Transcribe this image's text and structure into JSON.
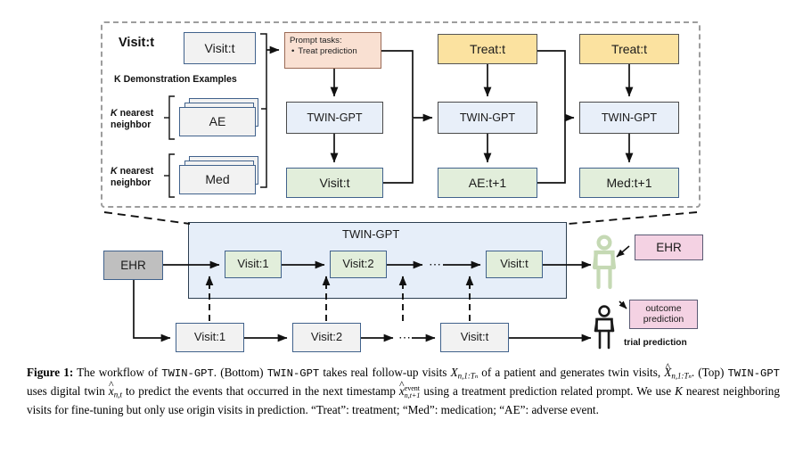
{
  "figure": {
    "top_panel": {
      "title_label": "Visit:t",
      "demo_label": "K Demonstration Examples",
      "knn_label_1_line1": "K",
      "knn_label_1_line2": " nearest",
      "knn_label_1_line3": "neighbor",
      "knn_label_2_line1": "K",
      "knn_label_2_line2": " nearest",
      "knn_label_2_line3": "neighbor",
      "visit_card": "Visit:t",
      "ae_stack": "AE",
      "med_stack": "Med",
      "prompt_title": "Prompt tasks:",
      "prompt_bullet": "Treat prediction",
      "twin_gpt_1": "TWIN-GPT",
      "twin_gpt_2": "TWIN-GPT",
      "twin_gpt_3": "TWIN-GPT",
      "out_1": "Visit:t",
      "out_2": "AE:t+1",
      "out_3": "Med:t+1",
      "treat_1": "Treat:t",
      "treat_2": "Treat:t"
    },
    "bottom_panel": {
      "panel_title": "TWIN-GPT",
      "ehr_source": "EHR",
      "twin_visits": [
        "Visit:1",
        "Visit:2",
        "Visit:t"
      ],
      "twin_ellipsis": "⋯",
      "real_visits": [
        "Visit:1",
        "Visit:2",
        "Visit:t"
      ],
      "real_ellipsis": "⋯",
      "ehr_result": "EHR",
      "outcome_line1": "outcome",
      "outcome_line2": "prediction",
      "trial_prediction": "trial prediction"
    },
    "colors": {
      "grey_box": "#f2f2f2",
      "blue_box": "#e8eff9",
      "green_box": "#e2eedb",
      "yellow_box": "#fbe2a0",
      "peach_box": "#f9e0d2",
      "pink_box": "#f4d2e3",
      "ehr_box": "#bfbfbf",
      "panel_blue": "#e6eef9",
      "dashed_border": "#9d9d9d",
      "twin_person": "#c5d9b4",
      "real_person": "#1a1a1a"
    }
  },
  "caption": {
    "figure_number": "Figure 1:",
    "seg_1": " The workflow of ",
    "mono_1": "TWIN-GPT",
    "seg_2": ". (Bottom) ",
    "mono_2": "TWIN-GPT",
    "seg_3": " takes real follow-up visits ",
    "math_1": "X",
    "math_1_sub": "n,1:T",
    "math_1_subsub": "n",
    "seg_4": " of a patient and generates twin visits, ",
    "math_2": "X",
    "math_2_sub": "n,1:T",
    "math_2_subsub": "n",
    "seg_5": ". (Top) ",
    "mono_3": "TWIN-GPT",
    "seg_6": " uses digital twin ",
    "math_3": "x",
    "math_3_sub": "n,t",
    "seg_7": " to predict the events that occurred in the next timestamp ",
    "math_4": "x",
    "math_4_sup": "event",
    "math_4_sub": "n,t+1",
    "seg_8": " using a treatment prediction related prompt. We use ",
    "math_5": "K",
    "seg_9": " nearest neighboring visits for fine-tuning but only use origin visits in prediction. “Treat”: treatment; “Med”: medication; “AE”: adverse event."
  }
}
